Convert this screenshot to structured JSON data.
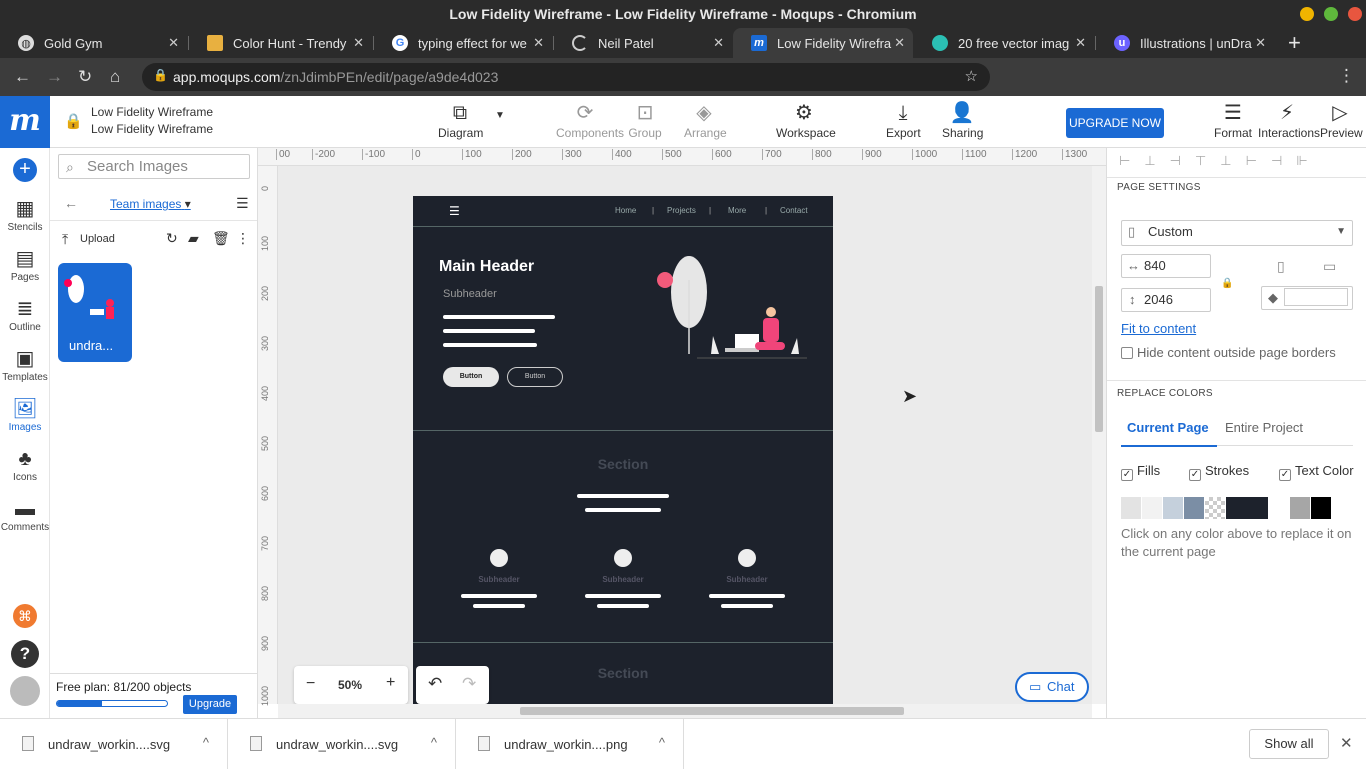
{
  "window": {
    "title": "Low Fidelity Wireframe - Low Fidelity Wireframe - Moqups - Chromium"
  },
  "tabs": [
    {
      "label": "Gold Gym",
      "icon": "globe-icon"
    },
    {
      "label": "Color Hunt - Trendy",
      "icon": "color-hunt-icon"
    },
    {
      "label": "typing effect for we",
      "icon": "google-icon"
    },
    {
      "label": "Neil Patel",
      "icon": "loading-icon"
    },
    {
      "label": "Low Fidelity Wirefra",
      "icon": "moqups-icon",
      "active": true
    },
    {
      "label": "20 free vector imag",
      "icon": "vector-site-icon"
    },
    {
      "label": "Illustrations | unDra",
      "icon": "undraw-icon"
    }
  ],
  "address": {
    "host": "app.moqups.com",
    "path": "/znJdimbPEn/edit/page/a9de4d023"
  },
  "doc": {
    "title1": "Low Fidelity Wireframe",
    "title2": "Low Fidelity Wireframe"
  },
  "toolbar": {
    "diagram": "Diagram",
    "components": "Components",
    "group": "Group",
    "arrange": "Arrange",
    "workspace": "Workspace",
    "export": "Export",
    "sharing": "Sharing",
    "upgrade": "UPGRADE NOW",
    "format": "Format",
    "interactions": "Interactions",
    "preview": "Preview"
  },
  "rail": [
    {
      "label": "Stencils",
      "icon": "stencils-icon"
    },
    {
      "label": "Pages",
      "icon": "pages-icon"
    },
    {
      "label": "Outline",
      "icon": "outline-icon"
    },
    {
      "label": "Templates",
      "icon": "templates-icon"
    },
    {
      "label": "Images",
      "icon": "images-icon",
      "active": true
    },
    {
      "label": "Icons",
      "icon": "icons-icon"
    },
    {
      "label": "Comments",
      "icon": "comments-icon"
    }
  ],
  "images_panel": {
    "search_placeholder": "Search Images",
    "folder": "Team images",
    "upload": "Upload",
    "thumb_label": "undra...",
    "plan": "Free plan: 81/200 objects",
    "plan_fraction": 0.405,
    "upgrade": "Upgrade"
  },
  "ruler": {
    "h": [
      "00",
      "-200",
      "-100",
      "0",
      "100",
      "200",
      "300",
      "400",
      "500",
      "600",
      "700",
      "800",
      "900",
      "1000",
      "1100",
      "1200",
      "1300"
    ],
    "v": [
      "0",
      "100",
      "200",
      "300",
      "400",
      "500",
      "600",
      "700",
      "800",
      "900",
      "1000"
    ]
  },
  "wireframe": {
    "nav": [
      "Home",
      "Projects",
      "More",
      "Contact"
    ],
    "main_header": "Main Header",
    "subheader": "Subheader",
    "button1": "Button",
    "button2": "Button",
    "section1": "Section",
    "col_subheader": "Subheader",
    "section2": "Section"
  },
  "canvas": {
    "zoom": "50%",
    "chat": "Chat"
  },
  "right_panel": {
    "page_settings": "PAGE SETTINGS",
    "preset": "Custom",
    "width": "840",
    "height": "2046",
    "fit": "Fit to content",
    "hide": "Hide content outside page borders",
    "replace_colors": "REPLACE COLORS",
    "tab_current": "Current Page",
    "tab_entire": "Entire Project",
    "fills": "Fills",
    "strokes": "Strokes",
    "text_color": "Text Color",
    "swatches": [
      "#e3e3e3",
      "#f2f2f2",
      "#c5d0dc",
      "#7b8ea5",
      "checker",
      "#1d222c",
      "#ffffff",
      "#a6a6a6",
      "#000000"
    ],
    "hint": "Click on any color above to replace it on the current page"
  },
  "downloads": {
    "items": [
      "undraw_workin....svg",
      "undraw_workin....svg",
      "undraw_workin....png"
    ],
    "show_all": "Show all"
  },
  "colors": {
    "accent": "#1b6ad4",
    "chrome_dark": "#2b2b2b",
    "wire_bg": "#1d222c"
  }
}
